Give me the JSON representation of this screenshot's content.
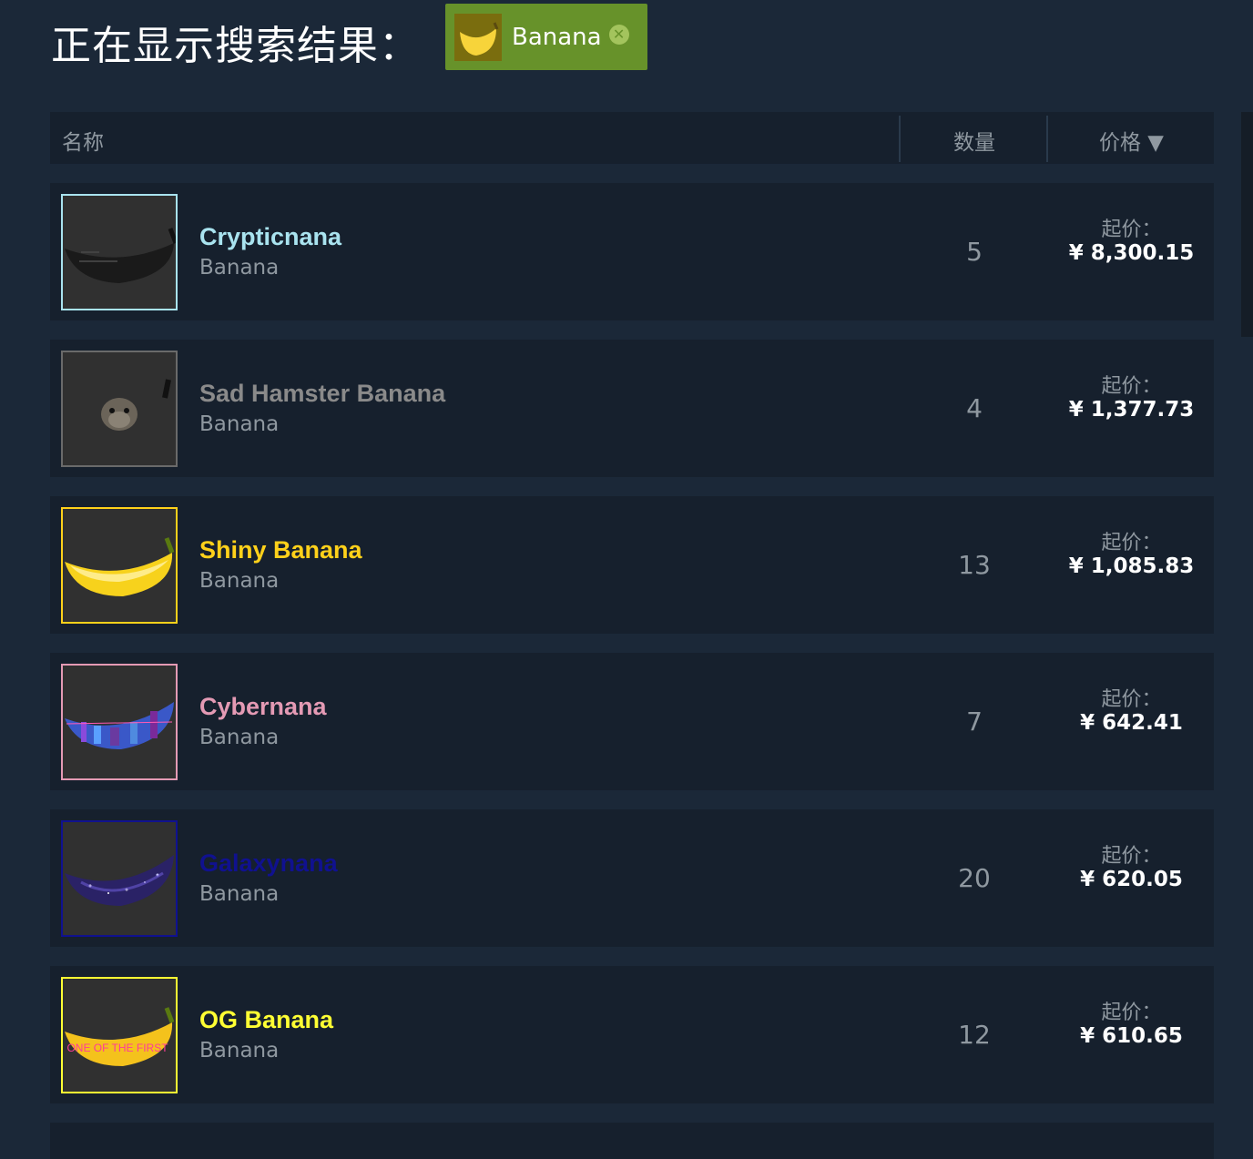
{
  "heading": "正在显示搜索结果：",
  "filter": {
    "label": "Banana",
    "thumb_icon": "banana-icon",
    "close_icon": "close-icon",
    "close_glyph": "✕"
  },
  "table_header": {
    "name": "名称",
    "quantity": "数量",
    "price": "价格 ▼"
  },
  "items": [
    {
      "name": "Crypticnana",
      "game": "Banana",
      "quantity": "5",
      "price_label": "起价：",
      "price": "¥ 8,300.15",
      "name_color": "#a9e3ef",
      "border_color": "#a9e3ef",
      "image": "black-banana-image"
    },
    {
      "name": "Sad Hamster Banana",
      "game": "Banana",
      "quantity": "4",
      "price_label": "起价：",
      "price": "¥ 1,377.73",
      "name_color": "#8a8a8a",
      "border_color": "#6a6a6a",
      "image": "hamster-banana-image"
    },
    {
      "name": "Shiny Banana",
      "game": "Banana",
      "quantity": "13",
      "price_label": "起价：",
      "price": "¥ 1,085.83",
      "name_color": "#ffd11a",
      "border_color": "#ffd11a",
      "image": "shiny-banana-image"
    },
    {
      "name": "Cybernana",
      "game": "Banana",
      "quantity": "7",
      "price_label": "起价：",
      "price": "¥ 642.41",
      "name_color": "#e49ab4",
      "border_color": "#e49ab4",
      "image": "cyber-banana-image"
    },
    {
      "name": "Galaxynana",
      "game": "Banana",
      "quantity": "20",
      "price_label": "起价：",
      "price": "¥ 620.05",
      "name_color": "#10118f",
      "border_color": "#10118f",
      "image": "galaxy-banana-image"
    },
    {
      "name": "OG Banana",
      "game": "Banana",
      "quantity": "12",
      "price_label": "起价：",
      "price": "¥ 610.65",
      "name_color": "#ffff33",
      "border_color": "#ffff33",
      "image": "og-banana-image",
      "image_text": "ONE OF THE FIRST"
    }
  ]
}
